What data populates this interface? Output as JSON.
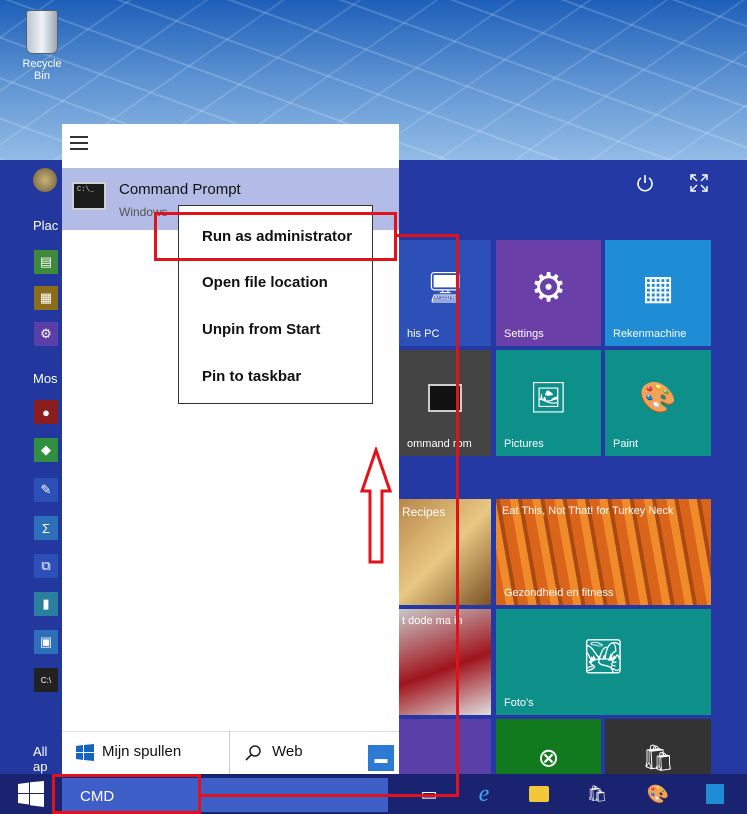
{
  "desktop": {
    "recycle_bin_label": "Recycle Bin"
  },
  "left_column": {
    "places_label": "Plac",
    "most_used_label": "Mos",
    "all_apps_label": "All ap"
  },
  "search_result": {
    "title": "Command Prompt",
    "subtitle": "Windows",
    "icon_text": "C:\\_"
  },
  "context_menu": {
    "items": [
      "Run as administrator",
      "Open file location",
      "Unpin from Start",
      "Pin to taskbar"
    ]
  },
  "panel_footer": {
    "my_stuff_label": "Mijn spullen",
    "web_label": "Web"
  },
  "tiles": {
    "this_pc": "his PC",
    "settings": "Settings",
    "calculator": "Rekenmachine",
    "command_prompt": "ommand rom",
    "pictures": "Pictures",
    "paint": "Paint",
    "recipes": "Recipes",
    "news_heading": "Eat This, Not That! for Turkey Neck",
    "news_category": "Gezondheid en fitness",
    "news_snippet": "t dode ma in",
    "photos": "Foto's"
  },
  "taskbar": {
    "search_value": "CMD"
  },
  "colors": {
    "accent": "#2439a3",
    "annotation": "#e3121a",
    "selection": "#b3bce6"
  },
  "icons": [
    "recycle-bin-icon",
    "hamburger-icon",
    "power-icon",
    "expand-icon",
    "settings-gear-icon",
    "calculator-icon",
    "paint-icon",
    "windows-logo-icon",
    "search-icon",
    "feedback-icon",
    "edge-icon",
    "explorer-icon",
    "store-icon",
    "up-arrow-icon"
  ]
}
